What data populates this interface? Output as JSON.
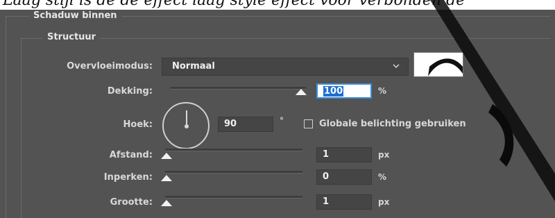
{
  "header_text": "Laag stijl is de de effect laag style effect voor verbonden de",
  "dialog": {
    "outer_group_title": "Schaduw binnen",
    "inner_group_title": "Structuur",
    "blend_mode": {
      "label": "Overvloeimodus:",
      "value": "Normaal"
    },
    "opacity": {
      "label": "Dekking:",
      "value": "100",
      "unit": "%",
      "slider_fraction": 1.0
    },
    "angle": {
      "label": "Hoek:",
      "value": "90",
      "unit": "°",
      "global_light_label": "Globale belichting gebruiken",
      "global_light_checked": false
    },
    "distance": {
      "label": "Afstand:",
      "value": "1",
      "unit": "px",
      "slider_fraction": 0.0
    },
    "choke": {
      "label": "Inperken:",
      "value": "0",
      "unit": "%",
      "slider_fraction": 0.0
    },
    "size": {
      "label": "Grootte:",
      "value": "1",
      "unit": "px",
      "slider_fraction": 0.0
    }
  },
  "colors": {
    "panel_bg": "#535353",
    "input_bg": "#454545",
    "selection_blue": "#1f6fd0",
    "swatch": "#ffffff"
  },
  "icons": {
    "dropdown": "chevron-down-icon",
    "angle_dial": "angle-dial-icon"
  }
}
